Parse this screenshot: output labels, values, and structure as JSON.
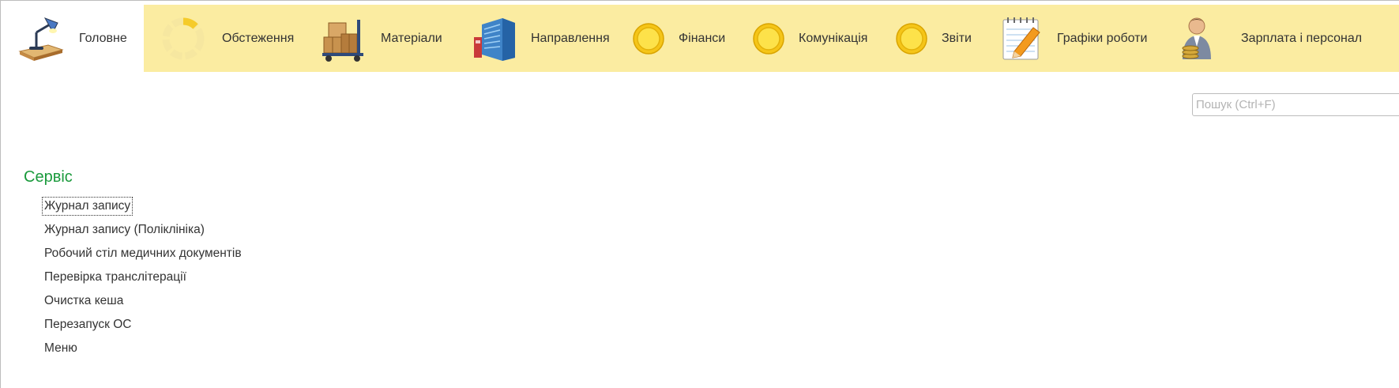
{
  "sections": [
    {
      "label": "Головне",
      "icon": "desk-lamp-icon",
      "active": true
    },
    {
      "label": "Обстеження",
      "icon": "loading-spinner-icon",
      "active": false
    },
    {
      "label": "Матеріали",
      "icon": "boxes-cart-icon",
      "active": false
    },
    {
      "label": "Направлення",
      "icon": "building-icon",
      "active": false
    },
    {
      "label": "Фінанси",
      "icon": "yellow-circle-icon",
      "active": false
    },
    {
      "label": "Комунікація",
      "icon": "yellow-circle-icon",
      "active": false
    },
    {
      "label": "Звіти",
      "icon": "yellow-circle-icon",
      "active": false
    },
    {
      "label": "Графіки роботи",
      "icon": "notepad-pencil-icon",
      "active": false
    },
    {
      "label": "Зарплата і персонал",
      "icon": "person-coins-icon",
      "active": false
    }
  ],
  "search": {
    "placeholder": "Пошук (Ctrl+F)",
    "value": ""
  },
  "service": {
    "title": "Сервіс",
    "commands": [
      "Журнал запису",
      "Журнал запису (Поліклініка)",
      "Робочий стіл медичних документів",
      "Перевірка транслітерації",
      "Очистка кеша",
      "Перезапуск ОС",
      "Меню"
    ],
    "focused_index": 0
  },
  "colors": {
    "panel_bg": "#fbeca1",
    "active_section_bg": "#ffffff",
    "group_title": "#1a9a3c",
    "text": "#333333"
  }
}
